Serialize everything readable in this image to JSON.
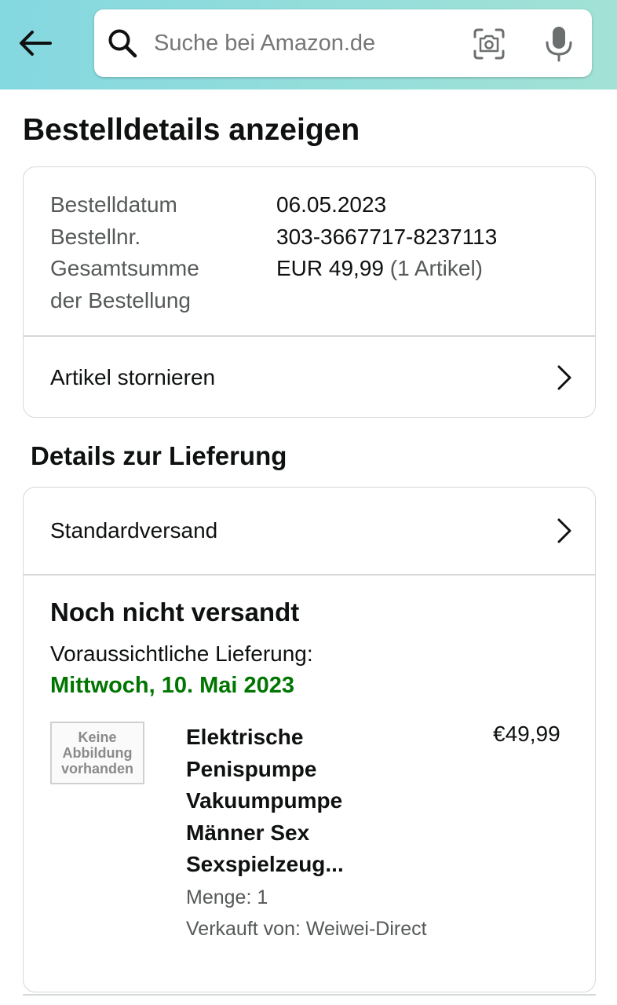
{
  "header": {
    "search_placeholder": "Suche bei Amazon.de",
    "icons": [
      "back-arrow-icon",
      "search-icon",
      "camera-icon",
      "microphone-icon"
    ]
  },
  "page": {
    "title": "Bestelldetails anzeigen"
  },
  "order": {
    "date_label": "Bestelldatum",
    "date_value": "06.05.2023",
    "number_label": "Bestellnr.",
    "number_value": "303-3667717-8237113",
    "total_label_line1": "Gesamtsumme",
    "total_label_line2": "der Bestellung",
    "total_amount": "EUR 49,99",
    "total_items": "(1 Artikel)",
    "cancel_link": "Artikel stornieren"
  },
  "delivery": {
    "section_title": "Details zur Lieferung",
    "shipping_method": "Standardversand",
    "status": "Noch nicht versandt",
    "expected_label": "Voraussichtliche Lieferung:",
    "expected_date": "Mittwoch, 10. Mai 2023"
  },
  "product": {
    "thumb_text_line1": "Keine",
    "thumb_text_line2": "Abbildung",
    "thumb_text_line3": "vorhanden",
    "title": "Elektrische Penispumpe Vakuumpumpe Männer Sex Sexspielzeug...",
    "price": "€49,99",
    "quantity": "Menge: 1",
    "seller": "Verkauft von: Weiwei-Direct"
  },
  "colors": {
    "header_gradient_start": "#84d8e0",
    "header_gradient_end": "#a2e2d6",
    "delivery_date_green": "#007600",
    "border": "#d5d9d9"
  }
}
